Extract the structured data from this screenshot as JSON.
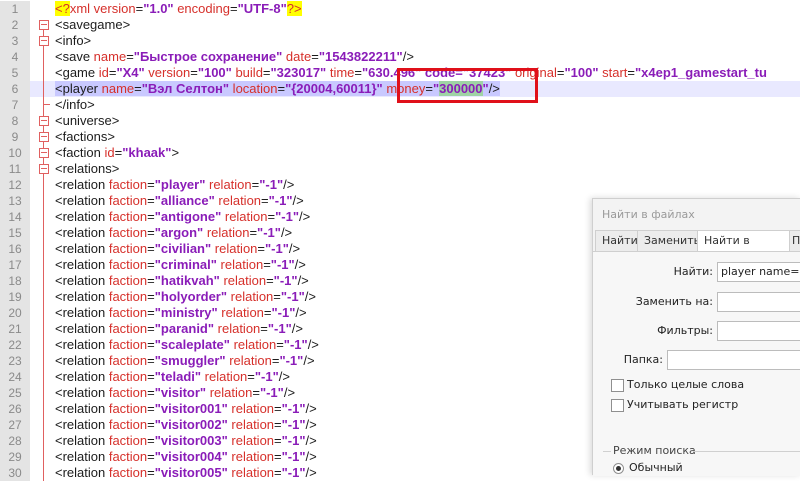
{
  "editor": {
    "lines": [
      {
        "n": "1",
        "segments": [
          {
            "t": "<?",
            "c": "pi"
          },
          {
            "t": "xml ",
            "c": "attr"
          },
          {
            "t": "version",
            "c": "attr"
          },
          {
            "t": "=",
            "c": "tag"
          },
          {
            "t": "\"1.0\"",
            "c": "val"
          },
          {
            "t": " encoding",
            "c": "attr"
          },
          {
            "t": "=",
            "c": "tag"
          },
          {
            "t": "\"UTF-8\"",
            "c": "val"
          },
          {
            "t": "?>",
            "c": "pi"
          }
        ]
      },
      {
        "n": "2",
        "segments": [
          {
            "t": "<savegame>",
            "c": "tag"
          }
        ]
      },
      {
        "n": "3",
        "segments": [
          {
            "t": "<info>",
            "c": "tag"
          }
        ]
      },
      {
        "n": "4",
        "segments": [
          {
            "t": "<save ",
            "c": "tag"
          },
          {
            "t": "name",
            "c": "attr"
          },
          {
            "t": "=",
            "c": "tag"
          },
          {
            "t": "\"Быстрое сохранение\"",
            "c": "val"
          },
          {
            "t": " date",
            "c": "attr"
          },
          {
            "t": "=",
            "c": "tag"
          },
          {
            "t": "\"1543822211\"",
            "c": "val"
          },
          {
            "t": "/>",
            "c": "tag"
          }
        ]
      },
      {
        "n": "5",
        "segments": [
          {
            "t": "<game ",
            "c": "tag"
          },
          {
            "t": "id",
            "c": "attr"
          },
          {
            "t": "=",
            "c": "tag"
          },
          {
            "t": "\"X4\"",
            "c": "val"
          },
          {
            "t": " version",
            "c": "attr"
          },
          {
            "t": "=",
            "c": "tag"
          },
          {
            "t": "\"100\"",
            "c": "val"
          },
          {
            "t": " build",
            "c": "attr"
          },
          {
            "t": "=",
            "c": "tag"
          },
          {
            "t": "\"323017\"",
            "c": "val"
          },
          {
            "t": " time",
            "c": "attr"
          },
          {
            "t": "=",
            "c": "tag"
          },
          {
            "t": "\"63",
            "c": "val"
          },
          {
            "t": "0.496\" code=\"37423\"",
            "c": "val"
          },
          {
            "t": " original",
            "c": "attr"
          },
          {
            "t": "=",
            "c": "tag"
          },
          {
            "t": "\"100\"",
            "c": "val"
          },
          {
            "t": " start",
            "c": "attr"
          },
          {
            "t": "=",
            "c": "tag"
          },
          {
            "t": "\"x4ep1_gamestart_tu",
            "c": "val"
          }
        ]
      },
      {
        "n": "6",
        "hl": true,
        "segments": [
          {
            "t": "<player ",
            "c": "tag hl"
          },
          {
            "t": "name",
            "c": "attr hl"
          },
          {
            "t": "=",
            "c": "tag hl"
          },
          {
            "t": "\"Вэл Селтон\"",
            "c": "val hl"
          },
          {
            "t": " location",
            "c": "attr hl"
          },
          {
            "t": "=",
            "c": "tag hl"
          },
          {
            "t": "\"{20004,60011}\"",
            "c": "val hl"
          },
          {
            "t": " money",
            "c": "attr hl"
          },
          {
            "t": "=",
            "c": "tag hl"
          },
          {
            "t": "\"",
            "c": "val hl"
          },
          {
            "t": "300000",
            "c": "val sel"
          },
          {
            "t": "\"",
            "c": "val hl"
          },
          {
            "t": "/>",
            "c": "tag hl"
          }
        ]
      },
      {
        "n": "7",
        "segments": [
          {
            "t": "</info>",
            "c": "tag"
          }
        ]
      },
      {
        "n": "8",
        "segments": [
          {
            "t": "<universe>",
            "c": "tag"
          }
        ]
      },
      {
        "n": "9",
        "segments": [
          {
            "t": "<factions>",
            "c": "tag"
          }
        ]
      },
      {
        "n": "10",
        "segments": [
          {
            "t": "<faction ",
            "c": "tag"
          },
          {
            "t": "id",
            "c": "attr"
          },
          {
            "t": "=",
            "c": "tag"
          },
          {
            "t": "\"khaak\"",
            "c": "val"
          },
          {
            "t": ">",
            "c": "tag"
          }
        ]
      },
      {
        "n": "11",
        "segments": [
          {
            "t": "<relations>",
            "c": "tag"
          }
        ]
      },
      {
        "n": "12",
        "rel": "player"
      },
      {
        "n": "13",
        "rel": "alliance"
      },
      {
        "n": "14",
        "rel": "antigone"
      },
      {
        "n": "15",
        "rel": "argon"
      },
      {
        "n": "16",
        "rel": "civilian"
      },
      {
        "n": "17",
        "rel": "criminal"
      },
      {
        "n": "18",
        "rel": "hatikvah"
      },
      {
        "n": "19",
        "rel": "holyorder"
      },
      {
        "n": "20",
        "rel": "ministry"
      },
      {
        "n": "21",
        "rel": "paranid"
      },
      {
        "n": "22",
        "rel": "scaleplate"
      },
      {
        "n": "23",
        "rel": "smuggler"
      },
      {
        "n": "24",
        "rel": "teladi"
      },
      {
        "n": "25",
        "rel": "visitor"
      },
      {
        "n": "26",
        "rel": "visitor001"
      },
      {
        "n": "27",
        "rel": "visitor002"
      },
      {
        "n": "28",
        "rel": "visitor003"
      },
      {
        "n": "29",
        "rel": "visitor004"
      },
      {
        "n": "30",
        "rel": "visitor005"
      }
    ],
    "relation_template": {
      "open": "<relation ",
      "faction_attr": "faction",
      "eq": "=",
      "relation_attr": " relation",
      "relation_value": "\"-1\"",
      "close": "/>"
    }
  },
  "find_panel": {
    "title": "Найти в файлах",
    "tabs": [
      "Найти",
      "Заменить",
      "Найти в файлах",
      "П"
    ],
    "active_tab": 2,
    "find_label": "Найти:",
    "find_value": "player name=",
    "replace_label": "Заменить на:",
    "replace_value": "",
    "filters_label": "Фильтры:",
    "filters_value": "",
    "folder_label": "Папка:",
    "folder_value": "",
    "whole_words_label": "Только целые слова",
    "match_case_label": "Учитывать регистр",
    "search_mode_label": "Режим поиска",
    "normal_mode_label": "Обычный"
  }
}
